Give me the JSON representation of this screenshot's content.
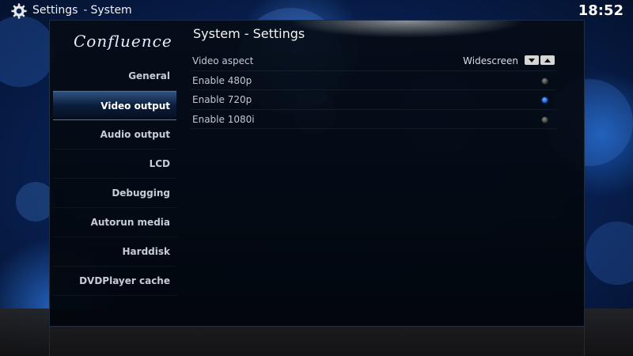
{
  "header": {
    "section": "Settings",
    "separator": "-",
    "page": "System",
    "clock": "18:52",
    "icon": "gear-icon"
  },
  "logo": {
    "text": "Confluence"
  },
  "content": {
    "title": "System - Settings"
  },
  "sidebar": {
    "items": [
      {
        "label": "General",
        "active": false
      },
      {
        "label": "Video output",
        "active": true
      },
      {
        "label": "Audio output",
        "active": false
      },
      {
        "label": "LCD",
        "active": false
      },
      {
        "label": "Debugging",
        "active": false
      },
      {
        "label": "Autorun media",
        "active": false
      },
      {
        "label": "Harddisk",
        "active": false
      },
      {
        "label": "DVDPlayer cache",
        "active": false
      }
    ]
  },
  "settings": {
    "items": [
      {
        "label": "Video aspect",
        "type": "spinner",
        "value": "Widescreen"
      },
      {
        "label": "Enable 480p",
        "type": "radio",
        "checked": false
      },
      {
        "label": "Enable 720p",
        "type": "radio",
        "checked": true
      },
      {
        "label": "Enable 1080i",
        "type": "radio",
        "checked": false
      }
    ]
  },
  "colors": {
    "accent": "#1b64d8",
    "background": "#082052",
    "panel": "#03080f"
  }
}
